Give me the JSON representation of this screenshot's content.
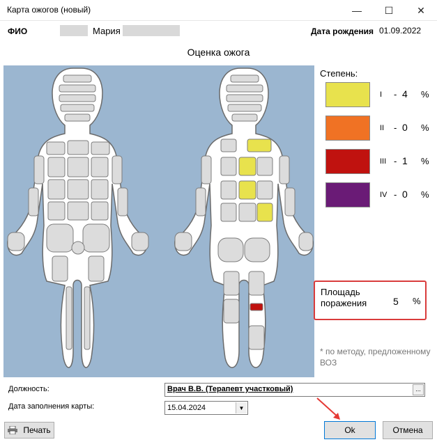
{
  "window": {
    "title": "Карта ожогов (новый)",
    "minimize": "—",
    "maximize": "☐",
    "close": "✕"
  },
  "patient": {
    "fio_label": "ФИО",
    "name": "Мария",
    "dob_label": "Дата рождения",
    "dob": "01.09.2022"
  },
  "assessment": {
    "title": "Оценка ожога"
  },
  "degree": {
    "title": "Степень:",
    "items": [
      {
        "roman": "I",
        "value": "4",
        "pct": "%",
        "color": "#e8e24d"
      },
      {
        "roman": "II",
        "value": "0",
        "pct": "%",
        "color": "#f07224"
      },
      {
        "roman": "III",
        "value": "1",
        "pct": "%",
        "color": "#c0120f"
      },
      {
        "roman": "IV",
        "value": "0",
        "pct": "%",
        "color": "#6a1b76"
      }
    ],
    "dash": "-"
  },
  "area": {
    "label": "Площадь поражения",
    "value": "5",
    "pct": "%"
  },
  "note": "* по методу, предложенному ВОЗ",
  "form": {
    "position_label": "Должность:",
    "position_value": "Врач В.В. (Терапевт участковый)",
    "ellipsis": "...",
    "date_label": "Дата заполнения карты:",
    "date_value": "15.04.2024"
  },
  "buttons": {
    "print": "Печать",
    "ok": "Ok",
    "cancel": "Отмена"
  },
  "colors": {
    "panel": "#9bb6d0",
    "highlight": "#d93b3b",
    "burn_1": "#e8e24d",
    "burn_3": "#c0120f"
  }
}
